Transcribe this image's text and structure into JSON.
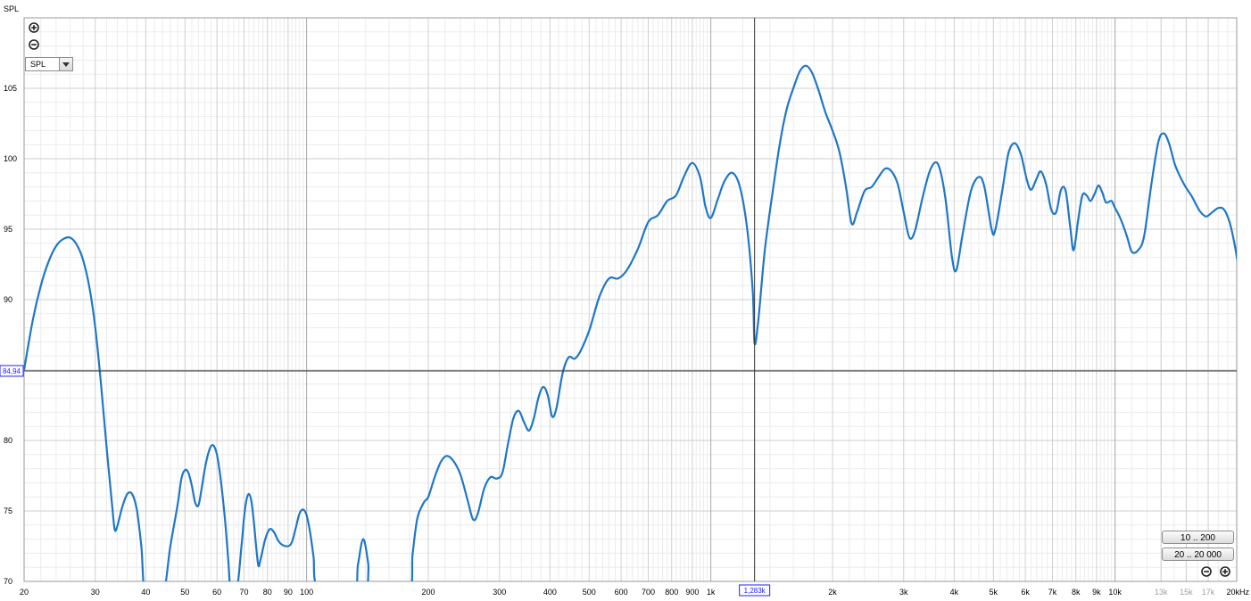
{
  "chart_data": {
    "type": "line",
    "ylabel": "SPL",
    "xlabel": "",
    "x_scale": "log",
    "xlim": [
      20,
      20000
    ],
    "ylim": [
      70,
      110
    ],
    "x_ticks": [
      {
        "v": 20,
        "label": "20",
        "dim": false
      },
      {
        "v": 30,
        "label": "30",
        "dim": false
      },
      {
        "v": 40,
        "label": "40",
        "dim": false
      },
      {
        "v": 50,
        "label": "50",
        "dim": false
      },
      {
        "v": 60,
        "label": "60",
        "dim": false
      },
      {
        "v": 70,
        "label": "70",
        "dim": false
      },
      {
        "v": 80,
        "label": "80",
        "dim": false
      },
      {
        "v": 90,
        "label": "90",
        "dim": false
      },
      {
        "v": 100,
        "label": "100",
        "dim": false
      },
      {
        "v": 200,
        "label": "200",
        "dim": false
      },
      {
        "v": 300,
        "label": "300",
        "dim": false
      },
      {
        "v": 400,
        "label": "400",
        "dim": false
      },
      {
        "v": 500,
        "label": "500",
        "dim": false
      },
      {
        "v": 600,
        "label": "600",
        "dim": false
      },
      {
        "v": 700,
        "label": "700",
        "dim": false
      },
      {
        "v": 800,
        "label": "800",
        "dim": false
      },
      {
        "v": 900,
        "label": "900",
        "dim": false
      },
      {
        "v": 1000,
        "label": "1k",
        "dim": false
      },
      {
        "v": 2000,
        "label": "2k",
        "dim": false
      },
      {
        "v": 3000,
        "label": "3k",
        "dim": false
      },
      {
        "v": 4000,
        "label": "4k",
        "dim": false
      },
      {
        "v": 5000,
        "label": "5k",
        "dim": false
      },
      {
        "v": 6000,
        "label": "6k",
        "dim": false
      },
      {
        "v": 7000,
        "label": "7k",
        "dim": false
      },
      {
        "v": 8000,
        "label": "8k",
        "dim": false
      },
      {
        "v": 9000,
        "label": "9k",
        "dim": false
      },
      {
        "v": 10000,
        "label": "10k",
        "dim": false
      },
      {
        "v": 13000,
        "label": "13k",
        "dim": true
      },
      {
        "v": 15000,
        "label": "15k",
        "dim": true
      },
      {
        "v": 17000,
        "label": "17k",
        "dim": true
      },
      {
        "v": 20000,
        "label": "20kHz",
        "dim": false
      }
    ],
    "y_ticks": [
      70,
      75,
      80,
      90,
      95,
      100,
      105
    ],
    "grid": true,
    "cursor": {
      "x": 1283,
      "y": 84.94,
      "x_label": "1,283k",
      "y_label": "84,94"
    },
    "series": [
      {
        "color": "#1f77c8",
        "points": [
          [
            20,
            85.0
          ],
          [
            21,
            88.5
          ],
          [
            22,
            91.0
          ],
          [
            23,
            92.7
          ],
          [
            24,
            93.8
          ],
          [
            25,
            94.3
          ],
          [
            26,
            94.4
          ],
          [
            27,
            93.9
          ],
          [
            28,
            92.8
          ],
          [
            29,
            90.9
          ],
          [
            30,
            88.0
          ],
          [
            31,
            84.0
          ],
          [
            32,
            79.5
          ],
          [
            33,
            75.5
          ],
          [
            33.5,
            73.7
          ],
          [
            34,
            73.9
          ],
          [
            35,
            75.3
          ],
          [
            36,
            76.2
          ],
          [
            37,
            76.2
          ],
          [
            38,
            75.1
          ],
          [
            39,
            72.5
          ],
          [
            40,
            69.0
          ],
          [
            44,
            69.0
          ],
          [
            46,
            72.5
          ],
          [
            48,
            75.5
          ],
          [
            49,
            77.3
          ],
          [
            50,
            77.9
          ],
          [
            51,
            77.7
          ],
          [
            52,
            76.8
          ],
          [
            53,
            75.6
          ],
          [
            54,
            75.4
          ],
          [
            55,
            76.6
          ],
          [
            56,
            78.0
          ],
          [
            57,
            79.0
          ],
          [
            58,
            79.6
          ],
          [
            59,
            79.6
          ],
          [
            60,
            79.0
          ],
          [
            61,
            77.7
          ],
          [
            62,
            76.0
          ],
          [
            63,
            74.0
          ],
          [
            64,
            71.5
          ],
          [
            65,
            69.0
          ],
          [
            67,
            69.0
          ],
          [
            69,
            72.5
          ],
          [
            70,
            74.5
          ],
          [
            71,
            75.8
          ],
          [
            72,
            76.2
          ],
          [
            73,
            75.7
          ],
          [
            74,
            74.3
          ],
          [
            75,
            72.5
          ],
          [
            76,
            71.1
          ],
          [
            77,
            71.6
          ],
          [
            79,
            73.0
          ],
          [
            81,
            73.7
          ],
          [
            83,
            73.5
          ],
          [
            85,
            72.9
          ],
          [
            87,
            72.6
          ],
          [
            90,
            72.5
          ],
          [
            92,
            72.8
          ],
          [
            94,
            73.8
          ],
          [
            96,
            74.8
          ],
          [
            98,
            75.1
          ],
          [
            100,
            74.7
          ],
          [
            102,
            73.5
          ],
          [
            104,
            71.8
          ],
          [
            107,
            69.5
          ],
          [
            130,
            69.0
          ],
          [
            134,
            71.2
          ],
          [
            138,
            73.0
          ],
          [
            142,
            71.3
          ],
          [
            145,
            69.0
          ],
          [
            178,
            69.0
          ],
          [
            183,
            72.0
          ],
          [
            188,
            74.5
          ],
          [
            195,
            75.6
          ],
          [
            200,
            76.0
          ],
          [
            208,
            77.5
          ],
          [
            215,
            78.5
          ],
          [
            222,
            78.9
          ],
          [
            230,
            78.6
          ],
          [
            240,
            77.6
          ],
          [
            250,
            75.8
          ],
          [
            258,
            74.4
          ],
          [
            265,
            74.8
          ],
          [
            275,
            76.6
          ],
          [
            285,
            77.4
          ],
          [
            295,
            77.3
          ],
          [
            305,
            77.7
          ],
          [
            315,
            79.8
          ],
          [
            325,
            81.6
          ],
          [
            335,
            82.1
          ],
          [
            345,
            81.3
          ],
          [
            355,
            80.7
          ],
          [
            365,
            81.6
          ],
          [
            375,
            83.1
          ],
          [
            385,
            83.8
          ],
          [
            395,
            83.2
          ],
          [
            405,
            81.7
          ],
          [
            415,
            82.3
          ],
          [
            430,
            84.8
          ],
          [
            445,
            85.9
          ],
          [
            460,
            85.8
          ],
          [
            475,
            86.3
          ],
          [
            500,
            87.8
          ],
          [
            530,
            90.2
          ],
          [
            560,
            91.5
          ],
          [
            590,
            91.5
          ],
          [
            620,
            92.1
          ],
          [
            660,
            93.6
          ],
          [
            700,
            95.5
          ],
          [
            740,
            96.0
          ],
          [
            780,
            97.0
          ],
          [
            820,
            97.4
          ],
          [
            860,
            98.8
          ],
          [
            900,
            99.7
          ],
          [
            940,
            98.7
          ],
          [
            970,
            96.6
          ],
          [
            1000,
            95.8
          ],
          [
            1040,
            97.1
          ],
          [
            1080,
            98.4
          ],
          [
            1130,
            99.0
          ],
          [
            1180,
            98.0
          ],
          [
            1230,
            95.0
          ],
          [
            1270,
            90.5
          ],
          [
            1283,
            86.9
          ],
          [
            1310,
            88.5
          ],
          [
            1360,
            93.5
          ],
          [
            1420,
            97.5
          ],
          [
            1480,
            101.0
          ],
          [
            1540,
            103.5
          ],
          [
            1600,
            105.0
          ],
          [
            1660,
            106.2
          ],
          [
            1720,
            106.6
          ],
          [
            1780,
            106.1
          ],
          [
            1850,
            104.8
          ],
          [
            1920,
            103.3
          ],
          [
            2000,
            102.0
          ],
          [
            2080,
            100.5
          ],
          [
            2160,
            98.0
          ],
          [
            2230,
            95.4
          ],
          [
            2300,
            96.2
          ],
          [
            2400,
            97.7
          ],
          [
            2500,
            98.0
          ],
          [
            2600,
            98.7
          ],
          [
            2700,
            99.3
          ],
          [
            2800,
            99.1
          ],
          [
            2900,
            98.2
          ],
          [
            3000,
            96.2
          ],
          [
            3100,
            94.4
          ],
          [
            3200,
            94.9
          ],
          [
            3350,
            97.4
          ],
          [
            3500,
            99.3
          ],
          [
            3650,
            99.6
          ],
          [
            3800,
            97.3
          ],
          [
            3950,
            93.0
          ],
          [
            4050,
            92.1
          ],
          [
            4200,
            94.7
          ],
          [
            4400,
            97.7
          ],
          [
            4600,
            98.7
          ],
          [
            4750,
            98.0
          ],
          [
            4950,
            95.0
          ],
          [
            5050,
            94.9
          ],
          [
            5250,
            97.6
          ],
          [
            5450,
            100.4
          ],
          [
            5650,
            101.1
          ],
          [
            5850,
            100.3
          ],
          [
            6050,
            98.5
          ],
          [
            6200,
            97.8
          ],
          [
            6400,
            98.6
          ],
          [
            6550,
            99.1
          ],
          [
            6750,
            98.2
          ],
          [
            6950,
            96.4
          ],
          [
            7150,
            96.2
          ],
          [
            7350,
            97.8
          ],
          [
            7550,
            97.7
          ],
          [
            7750,
            95.1
          ],
          [
            7900,
            93.5
          ],
          [
            8100,
            95.6
          ],
          [
            8300,
            97.4
          ],
          [
            8500,
            97.4
          ],
          [
            8700,
            97.0
          ],
          [
            8900,
            97.5
          ],
          [
            9100,
            98.1
          ],
          [
            9300,
            97.6
          ],
          [
            9500,
            96.9
          ],
          [
            9800,
            97.0
          ],
          [
            10000,
            96.5
          ],
          [
            10300,
            95.8
          ],
          [
            10700,
            94.5
          ],
          [
            11000,
            93.4
          ],
          [
            11400,
            93.5
          ],
          [
            11800,
            94.5
          ],
          [
            12300,
            98.2
          ],
          [
            12800,
            101.2
          ],
          [
            13200,
            101.8
          ],
          [
            13600,
            101.1
          ],
          [
            14100,
            99.5
          ],
          [
            14800,
            98.2
          ],
          [
            15500,
            97.3
          ],
          [
            16200,
            96.3
          ],
          [
            16800,
            95.9
          ],
          [
            17400,
            96.2
          ],
          [
            18000,
            96.5
          ],
          [
            18600,
            96.4
          ],
          [
            19200,
            95.5
          ],
          [
            19800,
            93.8
          ],
          [
            20400,
            91.5
          ],
          [
            21000,
            89.7
          ]
        ]
      }
    ]
  },
  "controls": {
    "zoom_in_icon": "zoom-in-icon",
    "zoom_out_icon": "zoom-out-icon",
    "dropdown_value": "SPL",
    "range_10_200": "10 .. 200",
    "range_20_20000": "20 .. 20 000"
  },
  "colors": {
    "curve": "#1f77c8",
    "cursor_label": "#2020ff"
  }
}
